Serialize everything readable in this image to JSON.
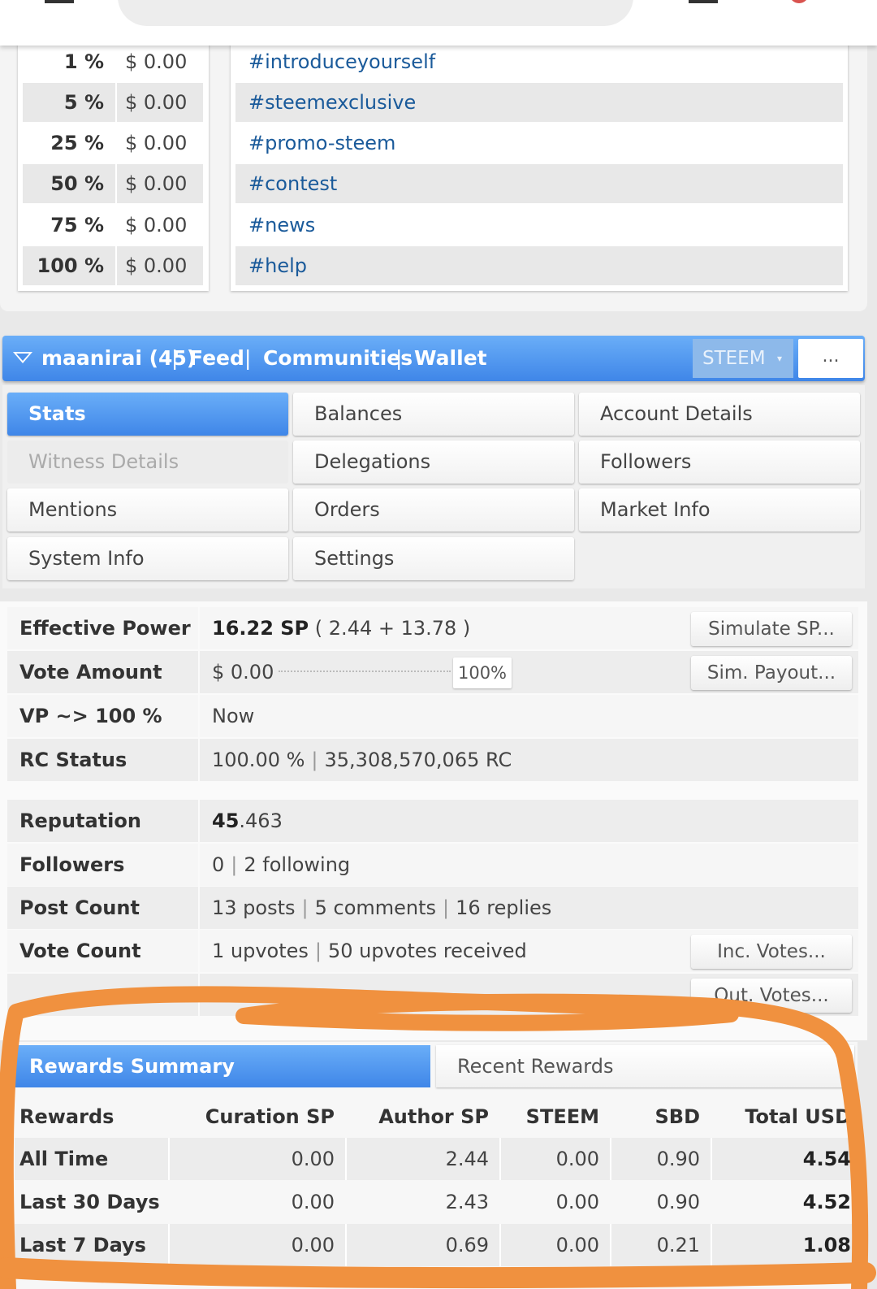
{
  "vote_values": [
    {
      "pct": "1 %",
      "usd": "$ 0.00"
    },
    {
      "pct": "5 %",
      "usd": "$ 0.00"
    },
    {
      "pct": "25 %",
      "usd": "$ 0.00"
    },
    {
      "pct": "50 %",
      "usd": "$ 0.00"
    },
    {
      "pct": "75 %",
      "usd": "$ 0.00"
    },
    {
      "pct": "100 %",
      "usd": "$ 0.00"
    }
  ],
  "tags": [
    "#introduceyourself",
    "#steemexclusive",
    "#promo-steem",
    "#contest",
    "#news",
    "#help"
  ],
  "account_bar": {
    "user": "maanirai (45)",
    "links": [
      "Feed",
      "Communities",
      "Wallet"
    ],
    "separator": "|",
    "chain": "STEEM",
    "chain_caret": "▾",
    "more": "..."
  },
  "menu": {
    "stats": "Stats",
    "balances": "Balances",
    "account_details": "Account Details",
    "witness_details": "Witness Details",
    "delegations": "Delegations",
    "followers": "Followers",
    "mentions": "Mentions",
    "orders": "Orders",
    "market_info": "Market Info",
    "system_info": "System Info",
    "settings": "Settings"
  },
  "stats": {
    "effective_power": {
      "label": "Effective Power",
      "value": "16.22 SP",
      "detail": "( 2.44 + 13.78 )",
      "button": "Simulate SP..."
    },
    "vote_amount": {
      "label": "Vote Amount",
      "value": "$ 0.00",
      "slider_pct": "100%",
      "button": "Sim. Payout..."
    },
    "vp": {
      "label": "VP ~> 100 %",
      "value": "Now"
    },
    "rc": {
      "label": "RC Status",
      "pct": "100.00 %",
      "amount": "35,308,570,065 RC"
    },
    "reputation": {
      "label": "Reputation",
      "whole": "45",
      "fraction": ".463"
    },
    "followers": {
      "label": "Followers",
      "count": "0",
      "following": "2 following"
    },
    "post_count": {
      "label": "Post Count",
      "posts": "13 posts",
      "comments": "5 comments",
      "replies": "16 replies"
    },
    "vote_count": {
      "label": "Vote Count",
      "given": "1 upvotes",
      "received": "50 upvotes received",
      "button": "Inc. Votes..."
    },
    "out_votes_button": "Out. Votes..."
  },
  "rewards": {
    "tab_active": "Rewards Summary",
    "tab_inactive": "Recent Rewards",
    "headers": [
      "Rewards",
      "Curation SP",
      "Author SP",
      "STEEM",
      "SBD",
      "Total USD"
    ],
    "rows": [
      {
        "period": "All Time",
        "curation_sp": "0.00",
        "author_sp": "2.44",
        "steem": "0.00",
        "sbd": "0.90",
        "total_usd": "4.54"
      },
      {
        "period": "Last 30 Days",
        "curation_sp": "0.00",
        "author_sp": "2.43",
        "steem": "0.00",
        "sbd": "0.90",
        "total_usd": "4.52"
      },
      {
        "period": "Last 7 Days",
        "curation_sp": "0.00",
        "author_sp": "0.69",
        "steem": "0.00",
        "sbd": "0.21",
        "total_usd": "1.08"
      }
    ]
  },
  "colors": {
    "accent_blue": "#4a90ec",
    "tag_link": "#1a5a9a",
    "annotation_orange": "#f0913f"
  }
}
